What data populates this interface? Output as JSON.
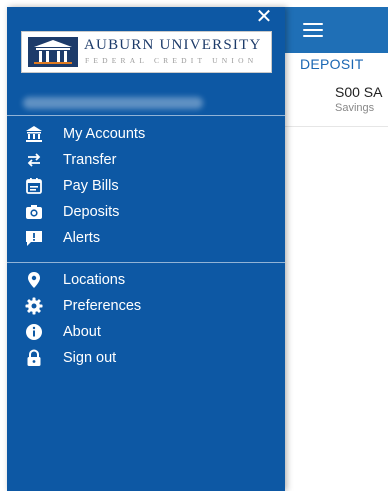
{
  "background_app": {
    "section_label": "DEPOSIT",
    "account_name": "S00 SA",
    "account_type": "Savings"
  },
  "drawer": {
    "logo": {
      "title": "AUBURN UNIVERSITY",
      "subtitle": "FEDERAL CREDIT UNION"
    },
    "primary_menu": [
      {
        "label": "My Accounts",
        "icon": "bank-icon"
      },
      {
        "label": "Transfer",
        "icon": "transfer-arrows-icon"
      },
      {
        "label": "Pay Bills",
        "icon": "bill-calendar-icon"
      },
      {
        "label": "Deposits",
        "icon": "camera-icon"
      },
      {
        "label": "Alerts",
        "icon": "alert-message-icon"
      }
    ],
    "secondary_menu": [
      {
        "label": "Locations",
        "icon": "location-pin-icon"
      },
      {
        "label": "Preferences",
        "icon": "gear-icon"
      },
      {
        "label": "About",
        "icon": "info-icon"
      },
      {
        "label": "Sign out",
        "icon": "lock-icon"
      }
    ]
  },
  "colors": {
    "drawer_bg": "#0d58a4",
    "header_bg": "#1f6fb6",
    "accent_text": "#1b67b3"
  }
}
